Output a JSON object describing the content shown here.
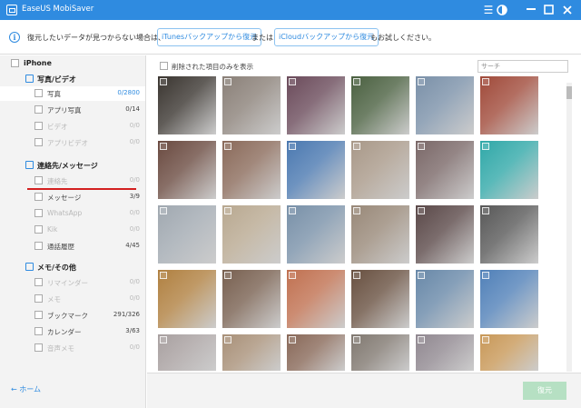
{
  "app": {
    "title": "EaseUS MobiSaver",
    "controls": [
      "menu",
      "theme",
      "minimize",
      "maximize",
      "close"
    ]
  },
  "infobar": {
    "text_before": "復元したいデータが見つからない場合は、",
    "link_itunes": "iTunesバックアップから復元",
    "text_or": "または",
    "link_icloud": "iCloudバックアップから復元",
    "text_after": "もお試しください。"
  },
  "sidebar": {
    "device": "iPhone",
    "categories": [
      {
        "label": "写真/ビデオ",
        "icon": "photo-icon",
        "items": [
          {
            "label": "写真",
            "count": "0/2800",
            "state": "selected"
          },
          {
            "label": "アプリ写真",
            "count": "0/14",
            "state": "normal"
          },
          {
            "label": "ビデオ",
            "count": "0/0",
            "state": "disabled"
          },
          {
            "label": "アプリビデオ",
            "count": "0/0",
            "state": "disabled"
          }
        ]
      },
      {
        "label": "連絡先/メッセージ",
        "icon": "contacts-icon",
        "items": [
          {
            "label": "連絡先",
            "count": "0/0",
            "state": "disabled"
          },
          {
            "label": "メッセージ",
            "count": "3/9",
            "state": "normal"
          },
          {
            "label": "WhatsApp",
            "count": "0/0",
            "state": "disabled"
          },
          {
            "label": "Kik",
            "count": "0/0",
            "state": "disabled"
          },
          {
            "label": "通話履歴",
            "count": "4/45",
            "state": "normal"
          }
        ]
      },
      {
        "label": "メモ/その他",
        "icon": "memo-icon",
        "items": [
          {
            "label": "リマインダー",
            "count": "0/0",
            "state": "disabled"
          },
          {
            "label": "メモ",
            "count": "0/0",
            "state": "disabled"
          },
          {
            "label": "ブックマーク",
            "count": "291/326",
            "state": "normal"
          },
          {
            "label": "カレンダー",
            "count": "3/63",
            "state": "normal"
          },
          {
            "label": "音声メモ",
            "count": "0/0",
            "state": "disabled"
          }
        ]
      }
    ],
    "home_label": "← ホーム"
  },
  "main": {
    "show_deleted_label": "削除された項目のみを表示",
    "search_placeholder": "サーチ",
    "thumb_colors": [
      [
        "#3a3530",
        "#8a8078",
        "#6a4a5a",
        "#4a6040",
        "#7a90a8",
        "#a04a3a"
      ],
      [
        "#6a4a40",
        "#8a6a5a",
        "#4a78b0",
        "#a89888",
        "#7a6868",
        "#30a8a8"
      ],
      [
        "#a0a8b0",
        "#b8a890",
        "#7890a8",
        "#988878",
        "#5a4848",
        "#585858"
      ],
      [
        "#b08040",
        "#786050",
        "#c07050",
        "#685040",
        "#6888a8",
        "#5080b8"
      ],
      [
        "#a8a0a0",
        "#a89078",
        "#886858",
        "#807870",
        "#908890",
        "#c89858"
      ]
    ]
  },
  "footer": {
    "restore_label": "復元"
  }
}
